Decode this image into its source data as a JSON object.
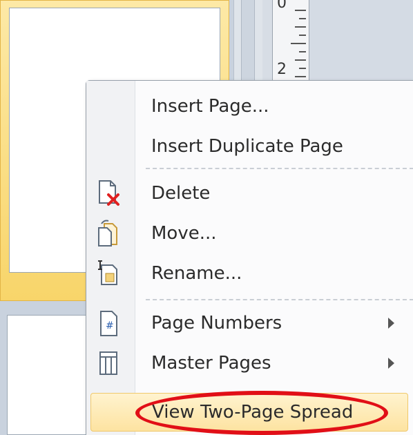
{
  "ruler": {
    "marks": [
      "0",
      "2"
    ]
  },
  "context_menu": {
    "items": [
      {
        "label": "Insert Page...",
        "icon": ""
      },
      {
        "label": "Insert Duplicate Page",
        "icon": ""
      },
      {
        "label": "Delete",
        "icon": "delete-page-icon"
      },
      {
        "label": "Move...",
        "icon": "move-page-icon"
      },
      {
        "label": "Rename...",
        "icon": "rename-page-icon"
      },
      {
        "label": "Page Numbers",
        "icon": "page-numbers-icon",
        "submenu": true
      },
      {
        "label": "Master Pages",
        "icon": "master-pages-icon",
        "submenu": true
      },
      {
        "label": "View Two-Page Spread",
        "icon": "",
        "highlighted": true
      }
    ]
  },
  "colors": {
    "highlight_fill": "#fde3a1",
    "annotation_ring": "#e10f17",
    "selected_thumbnail": "#f8d56a"
  }
}
